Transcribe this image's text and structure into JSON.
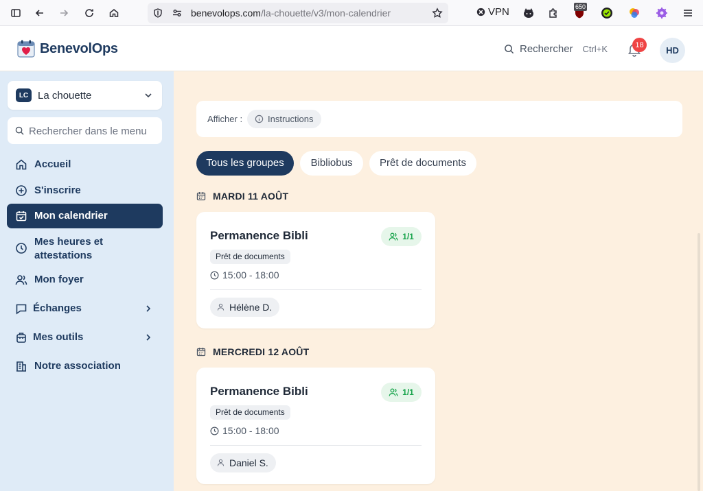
{
  "browser": {
    "url_domain": "benevolops.com",
    "url_path": "/la-chouette/v3/mon-calendrier",
    "vpn_label": "VPN",
    "ext_badge": "650"
  },
  "header": {
    "logo_text": "BenevolOps",
    "search_label": "Rechercher",
    "search_shortcut": "Ctrl+K",
    "notif_count": "18",
    "avatar_initials": "HD"
  },
  "sidebar": {
    "org": {
      "badge": "LC",
      "name": "La chouette"
    },
    "search_placeholder": "Rechercher dans le menu",
    "items": [
      {
        "label": "Accueil",
        "icon": "home-icon"
      },
      {
        "label": "S'inscrire",
        "icon": "plus-circle-icon"
      },
      {
        "label": "Mon calendrier",
        "icon": "calendar-check-icon",
        "active": true
      },
      {
        "label": "Mes heures et attestations",
        "icon": "clock-icon"
      },
      {
        "label": "Mon foyer",
        "icon": "users-icon"
      },
      {
        "label": "Échanges",
        "icon": "chat-icon",
        "has_chevron": true
      },
      {
        "label": "Mes outils",
        "icon": "toolbox-icon",
        "has_chevron": true
      },
      {
        "label": "Notre association",
        "icon": "building-icon"
      }
    ]
  },
  "main": {
    "filter_label": "Afficher :",
    "instructions_label": "Instructions",
    "tabs": [
      {
        "label": "Tous les groupes",
        "active": true
      },
      {
        "label": "Bibliobus"
      },
      {
        "label": "Prêt de documents"
      }
    ],
    "days": [
      {
        "heading": "MARDI 11 AOÛT",
        "events": [
          {
            "title": "Permanence Bibli",
            "capacity": "1/1",
            "group": "Prêt de documents",
            "time": "15:00 - 18:00",
            "volunteer": "Hélène D."
          }
        ]
      },
      {
        "heading": "MERCREDI 12 AOÛT",
        "events": [
          {
            "title": "Permanence Bibli",
            "capacity": "1/1",
            "group": "Prêt de documents",
            "time": "15:00 - 18:00",
            "volunteer": "Daniel S."
          }
        ]
      }
    ]
  },
  "colors": {
    "primary": "#1e3a5f",
    "sidebar_bg": "#dfebf7",
    "main_bg": "#fdf0e0",
    "success": "#16a34a",
    "notif": "#ef4444"
  }
}
